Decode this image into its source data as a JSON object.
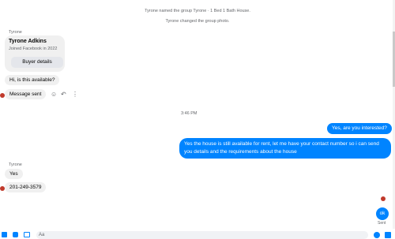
{
  "system_messages": {
    "renamed": "Tyrone named the group Tyrone · 1 Bed 1 Bath House.",
    "photo": "Tyrone changed the group photo."
  },
  "card": {
    "sender": "Tyrone",
    "name": "Tyrone Adkins",
    "joined": "Joined Facebook in 2022",
    "button": "Buyer details"
  },
  "messages_in_1": {
    "availability": "Hi, is this available?",
    "sent_status": "Message sent"
  },
  "timestamp": "3:46 PM",
  "messages_out": {
    "interested": "Yes, are you interested?",
    "details": "Yes the house is still available for rent, let me have your contact number so i can send you details and the requirements about the house"
  },
  "messages_in_2": {
    "sender": "Tyrone",
    "yes": "Yes",
    "phone": "201-249-3579"
  },
  "last_out": {
    "text": "ok",
    "status": "Sent"
  },
  "composer": {
    "placeholder": "Aa"
  },
  "colors": {
    "accent": "#0084ff",
    "incoming_bubble": "#f0f0f0",
    "avatar": "#c0392b"
  },
  "icons": [
    "smiley-icon",
    "reply-icon",
    "more-icon",
    "photo-icon",
    "sticker-icon",
    "gif-icon",
    "emoji-icon",
    "like-icon"
  ]
}
